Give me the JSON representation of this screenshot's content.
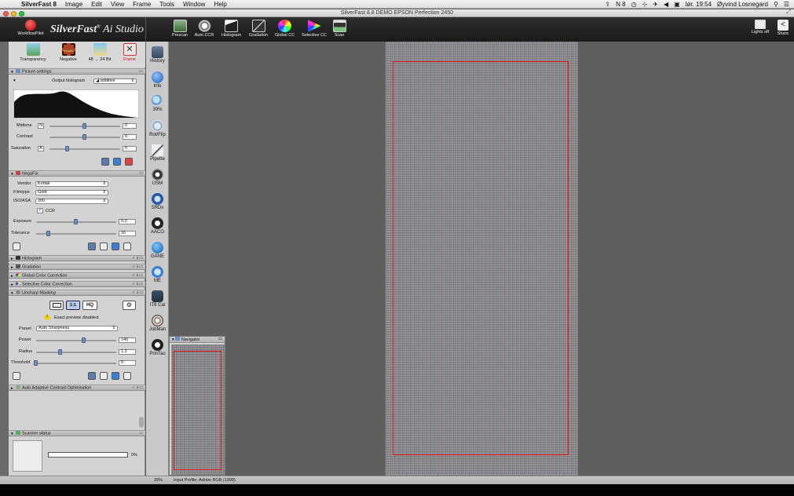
{
  "menubar": {
    "apple": "",
    "app_name": "SilverFast 8",
    "items": [
      "Image",
      "Edit",
      "View",
      "Frame",
      "Tools",
      "Window",
      "Help"
    ],
    "status_icons": [
      "⇪",
      "N 8",
      "◷",
      "⊹",
      "✈",
      "◀",
      "▣"
    ],
    "clock": "lør. 19:54",
    "user": "Øyvind Losnegard",
    "search_icon": "⚲",
    "list_icon": "☰"
  },
  "window": {
    "title": "SilverFast 8.8 DEMO  EPSON Perfection 2450",
    "zoom_icon": "⤢"
  },
  "toolbar": {
    "workflowpilot": "WorkflowPilot",
    "brand_main": "SilverFast",
    "brand_sup": "®",
    "brand_ai": "Ai Studio",
    "buttons": [
      "Prescan",
      "Auto CCR",
      "Histogram",
      "Gradation",
      "Global CC",
      "Selective CC",
      "Scan"
    ],
    "lights_off": "Lights off",
    "share": "Share"
  },
  "frame_buttons": [
    "Transparency",
    "Negative",
    "48 → 24 Bit",
    "Frame"
  ],
  "negative_badge": "Negativ",
  "picture_settings": {
    "header": "Picture settings",
    "output_histogram_label": "Output histogram",
    "mode": "additive",
    "midtone_label": "Midtone",
    "midtone_btn": "N",
    "midtone_value": "0",
    "contrast_label": "Contrast",
    "contrast_value": "0",
    "saturation_label": "Saturation",
    "saturation_btn": "A",
    "saturation_value": "0",
    "midtone_pos": 0.5,
    "contrast_pos": 0.5,
    "saturation_pos": 0.25
  },
  "negafix": {
    "header": "NegaFix",
    "vendor_label": "Vendor",
    "vendor": "Kodak",
    "filmtype_label": "Filmtype",
    "filmtype": "Gold",
    "iso_label": "ISO/ASA",
    "iso": "200",
    "ccr_check": "✔",
    "ccr_label": "CCR",
    "exposure_label": "Exposure",
    "exposure_value": "0.0",
    "tolerance_label": "Tolerance",
    "tolerance_value": "16",
    "exposure_pos": 0.5,
    "tolerance_pos": 0.16
  },
  "collapsed_sections": [
    "Histogram",
    "Gradation",
    "Global Color Correction",
    "Selective Color Correction"
  ],
  "usm": {
    "header": "Unsharp Masking",
    "btn_1to1": "1:1",
    "btn_hq": "HQ",
    "warning": "Exact preview disabled.",
    "preset_label": "Preset",
    "preset": "Auto Sharpness",
    "power_label": "Power",
    "power_value": "140",
    "radius_label": "Radius",
    "radius_value": "1.2",
    "threshold_label": "Threshold",
    "threshold_value": "0",
    "power_pos": 0.6,
    "radius_pos": 0.3,
    "threshold_pos": 0.0
  },
  "aaco_section": "Auto Adaptive Contrast Optimisation",
  "scanner_status": {
    "header": "Scanner status",
    "progress": "0%",
    "progress_value": 0
  },
  "tools": [
    "History",
    "Info",
    "39%",
    "Rot/Flip",
    "Pipette",
    "USM",
    "SRDx",
    "AACO",
    "GANE",
    "ME",
    "IT8 Cal",
    "JobMan",
    "PrinTao"
  ],
  "navigator": {
    "header": "Navigator"
  },
  "statusbar": {
    "zoom": "39%",
    "profile": "Input Profile: Adobe RGB (1998)"
  },
  "colors": {
    "frame_red": "#e01818",
    "toolbar_dark": "#202020",
    "panel_gray": "#d3d3d3",
    "slider_knob": "#6f8fb8"
  }
}
